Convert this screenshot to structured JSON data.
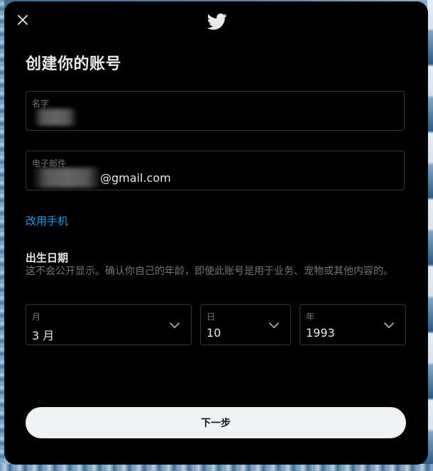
{
  "colors": {
    "modal_bg": "#000000",
    "text_primary": "#e7e9ea",
    "text_secondary": "#71767b",
    "link": "#1d9bf0",
    "border": "#333639",
    "button_bg": "#eff3f4"
  },
  "header": {
    "close_icon": "close-icon",
    "logo_icon": "twitter-bird-icon"
  },
  "form": {
    "title": "创建你的账号",
    "name_field": {
      "label": "名字",
      "value": ""
    },
    "email_field": {
      "label": "电子邮件",
      "value_visible_suffix": "@gmail.com"
    },
    "use_phone_link": "改用手机",
    "dob": {
      "title": "出生日期",
      "description": "这不会公开显示。确认你自己的年龄，即使此账号是用于业务、宠物或其他内容的。",
      "month": {
        "label": "月",
        "value": "3 月"
      },
      "day": {
        "label": "日",
        "value": "10"
      },
      "year": {
        "label": "年",
        "value": "1993"
      }
    },
    "next_button": "下一步"
  }
}
